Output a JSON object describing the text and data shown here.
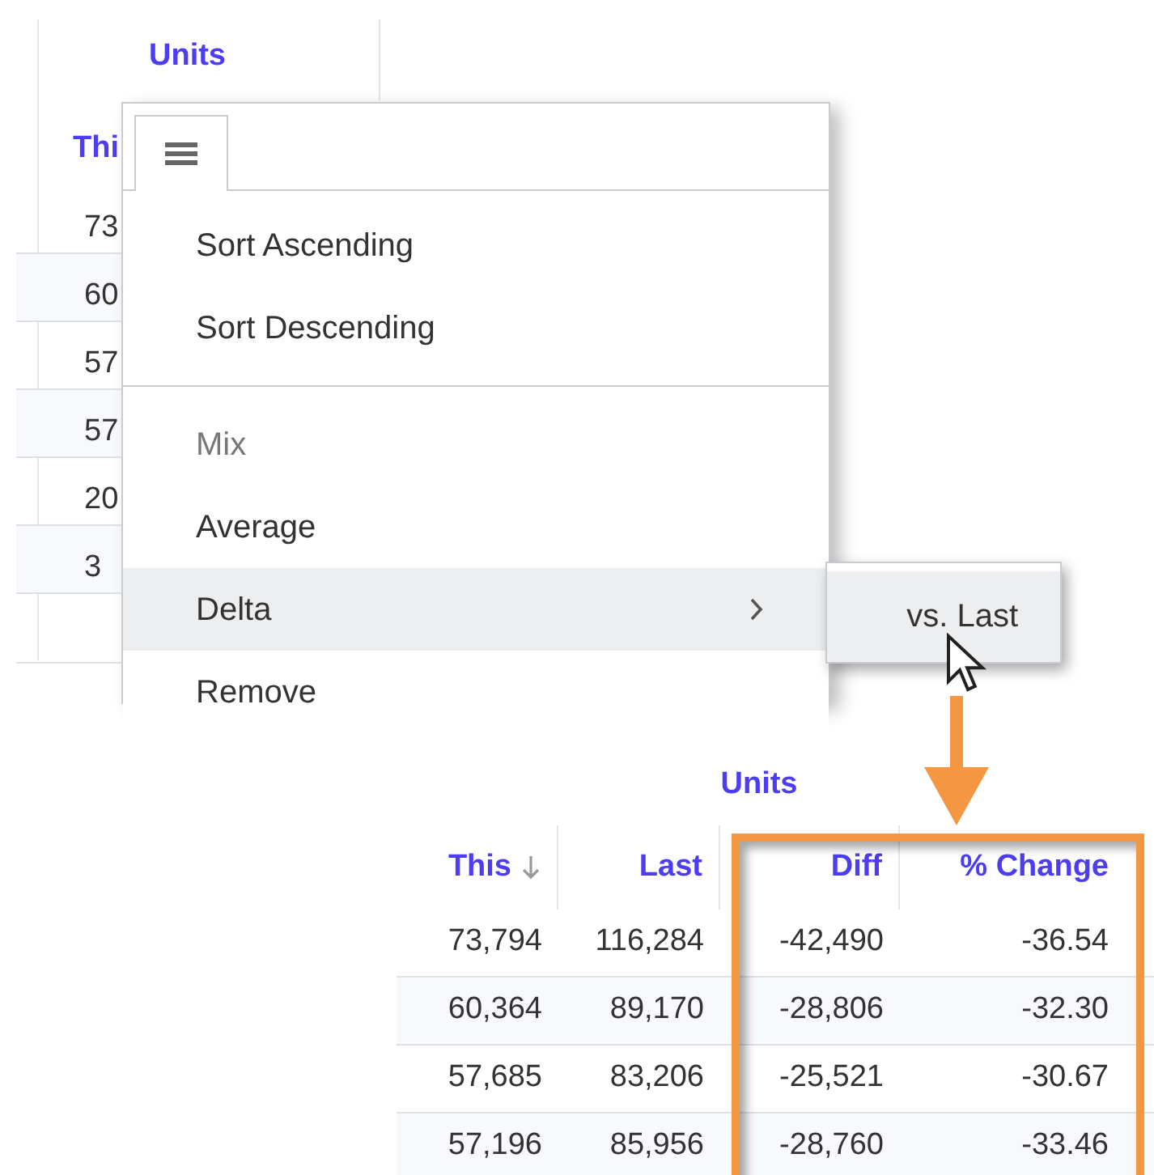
{
  "background_table": {
    "group_header": "Units",
    "column_header": "Thi",
    "cells": [
      "73",
      "60",
      "57",
      "57",
      "20",
      "3"
    ]
  },
  "column_menu": {
    "items": [
      {
        "kind": "item",
        "label": "Sort Ascending",
        "disabled": false,
        "highlighted": false,
        "has_submenu": false
      },
      {
        "kind": "item",
        "label": "Sort Descending",
        "disabled": false,
        "highlighted": false,
        "has_submenu": false
      },
      {
        "kind": "separator"
      },
      {
        "kind": "item",
        "label": "Mix",
        "disabled": true,
        "highlighted": false,
        "has_submenu": false
      },
      {
        "kind": "item",
        "label": "Average",
        "disabled": false,
        "highlighted": false,
        "has_submenu": false
      },
      {
        "kind": "item",
        "label": "Delta",
        "disabled": false,
        "highlighted": true,
        "has_submenu": true
      },
      {
        "kind": "item",
        "label": "Remove",
        "disabled": false,
        "highlighted": false,
        "has_submenu": false
      }
    ]
  },
  "submenu": {
    "items": [
      {
        "label": "vs. Last",
        "highlighted": true
      }
    ]
  },
  "result_table": {
    "group_header": "Units",
    "columns": [
      {
        "label": "This",
        "sorted_descending": true
      },
      {
        "label": "Last",
        "sorted_descending": false
      },
      {
        "label": "Diff",
        "sorted_descending": false
      },
      {
        "label": "% Change",
        "sorted_descending": false
      }
    ],
    "rows": [
      [
        "73,794",
        "116,284",
        "-42,490",
        "-36.54"
      ],
      [
        "60,364",
        "89,170",
        "-28,806",
        "-32.30"
      ],
      [
        "57,685",
        "83,206",
        "-25,521",
        "-30.67"
      ],
      [
        "57,196",
        "85,956",
        "-28,760",
        "-33.46"
      ]
    ]
  }
}
